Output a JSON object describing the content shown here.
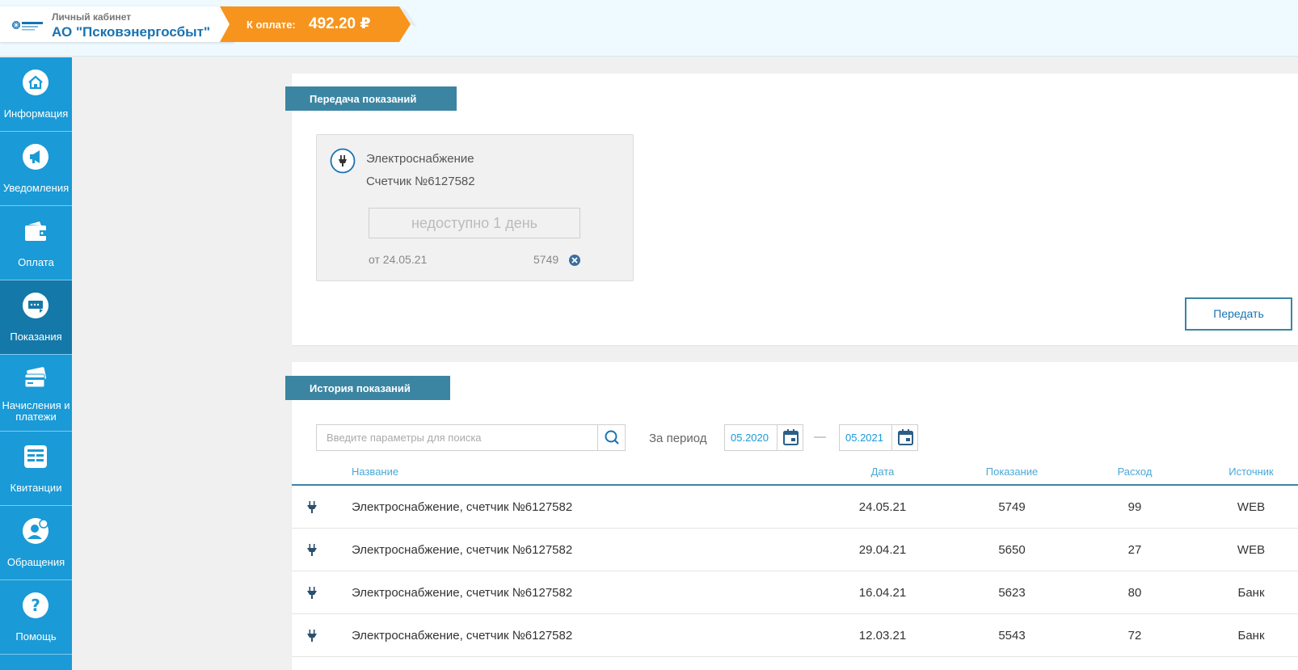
{
  "header": {
    "subtitle": "Личный кабинет",
    "title": "АО \"Псковэнергосбыт\"",
    "pay_label": "К оплате:",
    "pay_amount": "492.20 ₽",
    "accent_color": "#f7941d"
  },
  "sidebar": {
    "items": [
      {
        "label": "Информация",
        "icon": "home-icon"
      },
      {
        "label": "Уведомления",
        "icon": "megaphone-icon"
      },
      {
        "label": "Оплата",
        "icon": "wallet-icon"
      },
      {
        "label": "Показания",
        "icon": "meter-readings-icon",
        "active": true
      },
      {
        "label": "Начисления и платежи",
        "icon": "card-icon"
      },
      {
        "label": "Квитанции",
        "icon": "receipt-icon"
      },
      {
        "label": "Обращения",
        "icon": "user-chat-icon"
      },
      {
        "label": "Помощь",
        "icon": "help-icon"
      }
    ]
  },
  "submit_section": {
    "title": "Передача показаний",
    "card": {
      "icon": "plug-icon",
      "type": "Электроснабжение",
      "meter": "Счетчик №6127582",
      "input_placeholder": "недоступно 1 день",
      "last_date": "от 24.05.21",
      "last_value": "5749"
    },
    "submit_label": "Передать"
  },
  "history": {
    "title": "История показаний",
    "search_placeholder": "Введите параметры для поиска",
    "period_label": "За период",
    "date_from": "05.2020",
    "date_to": "05.2021",
    "dash": "—",
    "columns": [
      "Название",
      "Дата",
      "Показание",
      "Расход",
      "Источник"
    ],
    "rows": [
      {
        "name": "Электроснабжение, счетчик №6127582",
        "date": "24.05.21",
        "reading": "5749",
        "usage": "99",
        "source": "WEB"
      },
      {
        "name": "Электроснабжение, счетчик №6127582",
        "date": "29.04.21",
        "reading": "5650",
        "usage": "27",
        "source": "WEB"
      },
      {
        "name": "Электроснабжение, счетчик №6127582",
        "date": "16.04.21",
        "reading": "5623",
        "usage": "80",
        "source": "Банк"
      },
      {
        "name": "Электроснабжение, счетчик №6127582",
        "date": "12.03.21",
        "reading": "5543",
        "usage": "72",
        "source": "Банк"
      }
    ]
  }
}
